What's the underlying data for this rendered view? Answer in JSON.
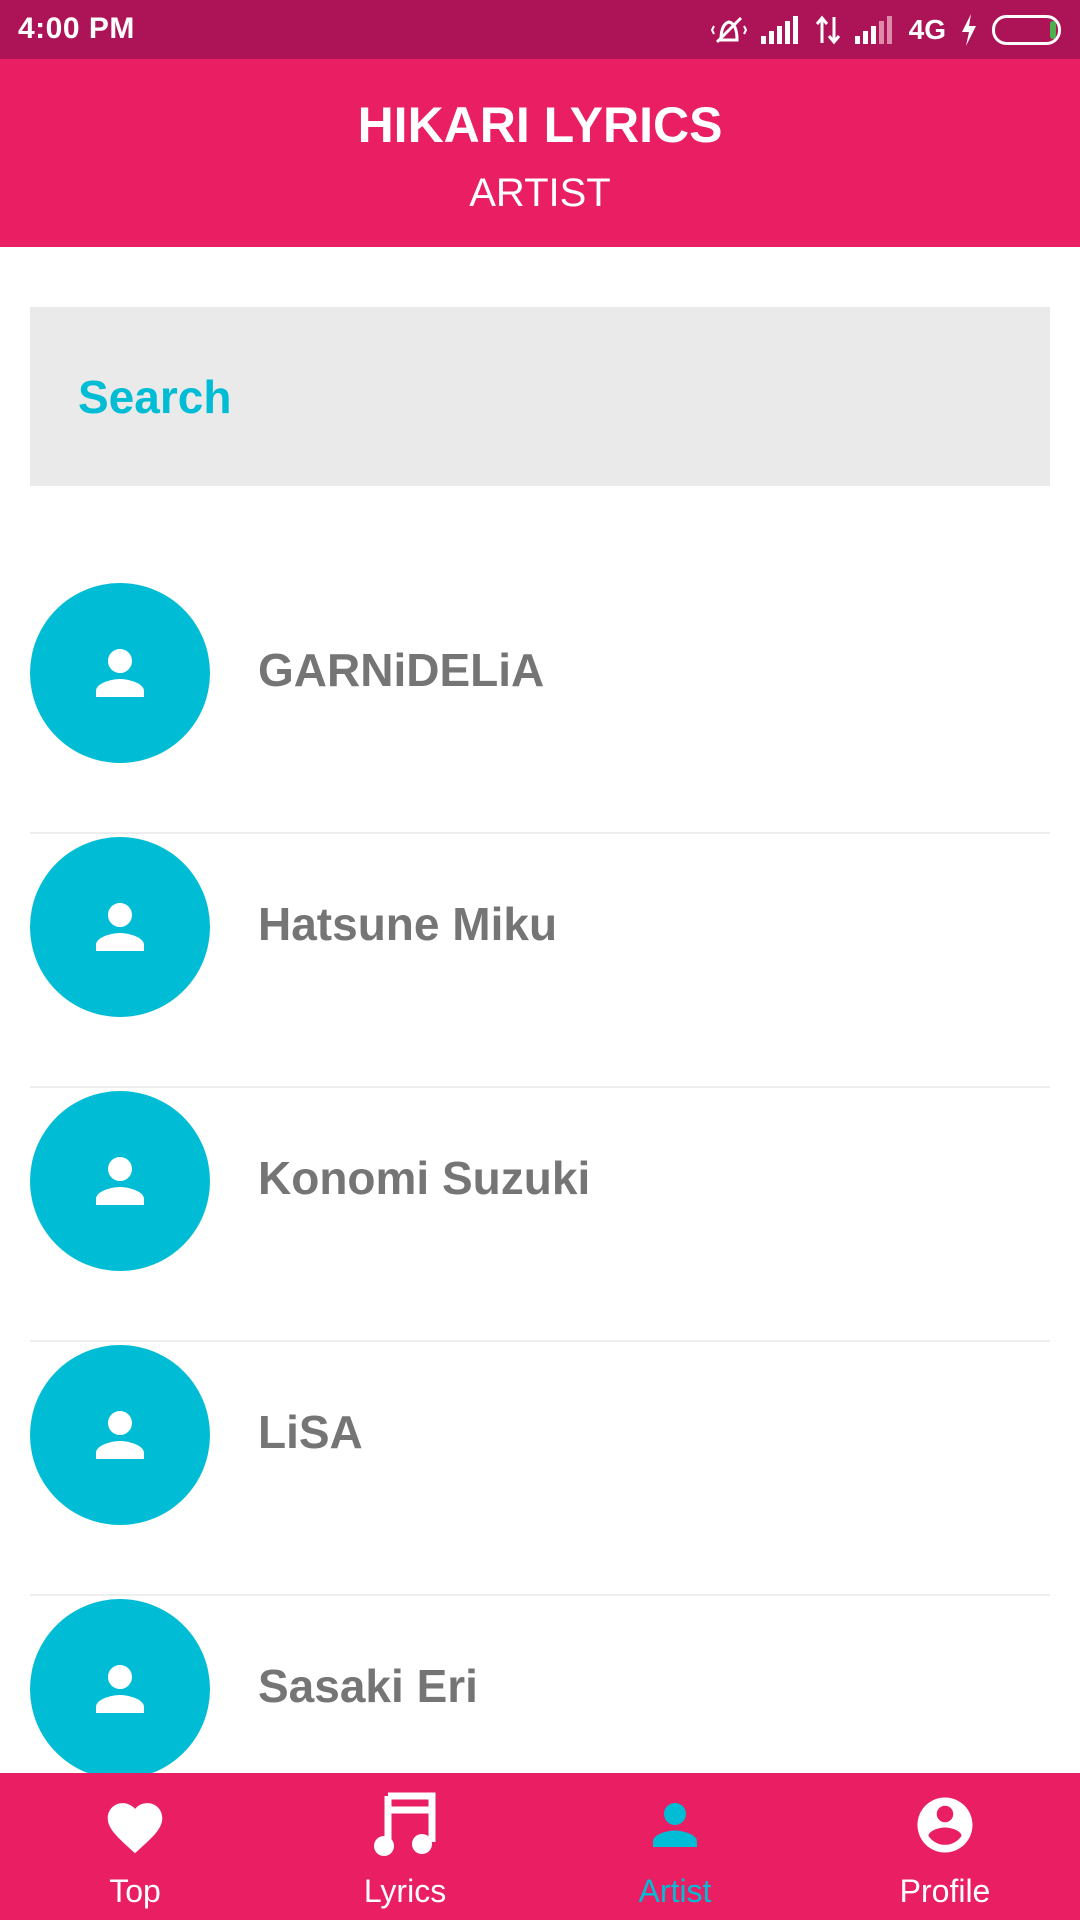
{
  "status_bar": {
    "time": "4:00 PM",
    "network": "4G",
    "icons": [
      "vibrate-off-icon",
      "signal-icon",
      "data-transfer-icon",
      "signal-icon",
      "charging-icon",
      "battery-icon"
    ]
  },
  "app_bar": {
    "title": "HIKARI LYRICS",
    "subtitle": "ARTIST"
  },
  "search": {
    "placeholder": "Search",
    "value": ""
  },
  "artists": [
    {
      "name": "GARNiDELiA",
      "icon": "person-icon"
    },
    {
      "name": "Hatsune Miku",
      "icon": "person-icon"
    },
    {
      "name": "Konomi Suzuki",
      "icon": "person-icon"
    },
    {
      "name": "LiSA",
      "icon": "person-icon"
    },
    {
      "name": "Sasaki Eri",
      "icon": "person-icon"
    }
  ],
  "bottom_nav": {
    "items": [
      {
        "label": "Top",
        "icon": "heart-icon"
      },
      {
        "label": "Lyrics",
        "icon": "music-note-icon"
      },
      {
        "label": "Artist",
        "icon": "person-icon"
      },
      {
        "label": "Profile",
        "icon": "account-circle-icon"
      }
    ],
    "active": "Artist"
  },
  "colors": {
    "status_bar": "#ad1457",
    "primary": "#e91e63",
    "accent": "#00bcd4",
    "list_text": "#757575",
    "search_bg": "#eaeaea"
  }
}
